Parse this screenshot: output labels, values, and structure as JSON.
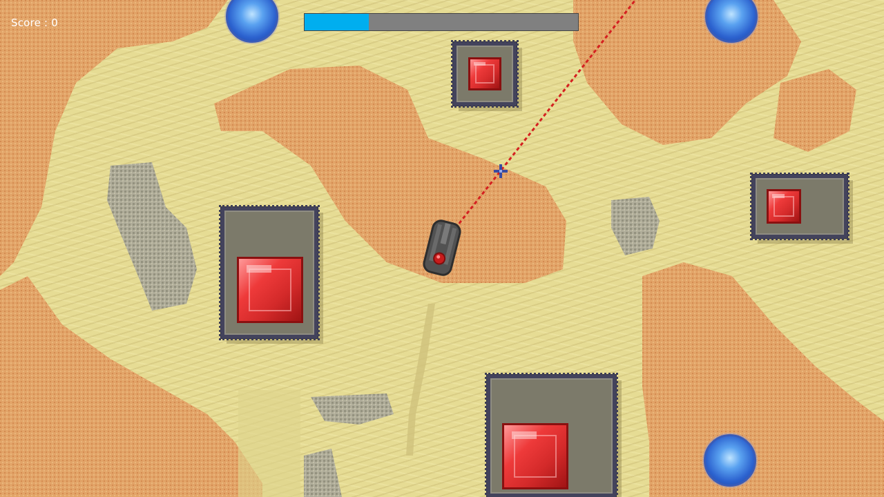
{
  "hud": {
    "score_label": "Score : 0",
    "health_percent": 23.5
  },
  "colors": {
    "sand": "#e6dc94",
    "dune": "#e0a064",
    "rock": "#a8a69c",
    "health_fill": "#00aeef",
    "health_track": "#808080",
    "laser": "#d42020",
    "gem": "#e23434",
    "orb": "#3a72dd"
  },
  "entities": {
    "player": "tank",
    "enemy_bases": "red-gem-base",
    "pickups": "blue-orb",
    "cursor": "crosshair"
  }
}
